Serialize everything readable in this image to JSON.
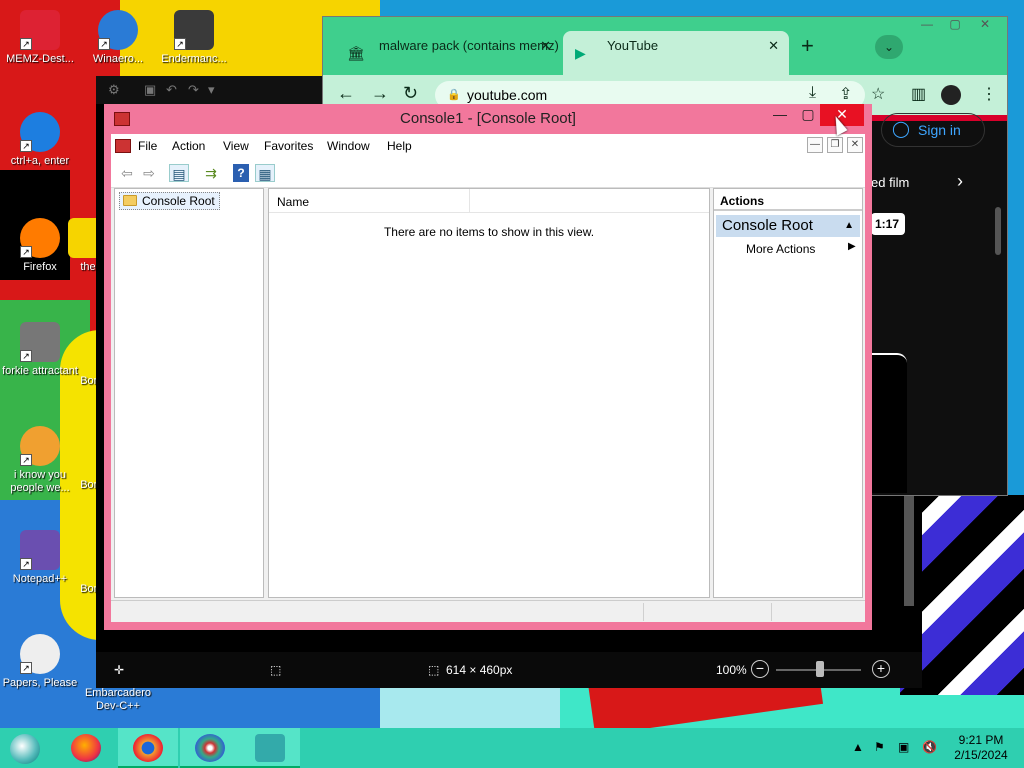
{
  "desktop": {
    "icons": [
      {
        "label": "MEMZ-Dest...",
        "color": "#d23"
      },
      {
        "label": "Winaero...",
        "color": "#2a7bd6"
      },
      {
        "label": "Endermanc...",
        "color": "#3a3a3a"
      },
      {
        "label": "ctrl+a, enter",
        "color": "#1d7ee0"
      },
      {
        "label": "Firefox",
        "color": "#ff7b00"
      },
      {
        "label": "the",
        "color": "#f6d400"
      },
      {
        "label": "forkie attractant",
        "color": "#777"
      },
      {
        "label": "Bon",
        "color": "#2a7bd6"
      },
      {
        "label": "i know you people we...",
        "color": "#f0a030"
      },
      {
        "label": "Bon",
        "color": "#2a7bd6"
      },
      {
        "label": "Notepad++",
        "color": "#6a4fb0"
      },
      {
        "label": "Bon",
        "color": "#2a7bd6"
      },
      {
        "label": "Papers, Please",
        "color": "#ddd"
      },
      {
        "label": "Embarcadero Dev-C++",
        "color": "#c22"
      }
    ]
  },
  "viewer": {
    "dimensions_label": "614 × 460px",
    "zoom_label": "100%",
    "zoom_out": "−",
    "zoom_in": "+"
  },
  "chrome": {
    "tabs": [
      {
        "title": "malware pack (contains memz)",
        "icon": "bank-icon",
        "close": "✕"
      },
      {
        "title": "YouTube",
        "icon": "play-icon",
        "close": "✕"
      }
    ],
    "new_tab": "+",
    "dropdown": "⌄",
    "url": "youtube.com",
    "signin": "Sign in",
    "film_text": "ed film",
    "time_badge": "1:17",
    "controls": {
      "minimize": "—",
      "maximize": "▢",
      "close": "✕"
    }
  },
  "mmc": {
    "title": "Console1 - [Console Root]",
    "controls": {
      "minimize": "—",
      "maximize": "▢",
      "close": "✕"
    },
    "child_controls": {
      "minimize": "—",
      "restore": "❐",
      "close": "✕"
    },
    "menu": [
      "File",
      "Action",
      "View",
      "Favorites",
      "Window",
      "Help"
    ],
    "tree_root": "Console Root",
    "column_name": "Name",
    "empty_message": "There are no items to show in this view.",
    "actions": {
      "header": "Actions",
      "group": "Console Root",
      "item": "More Actions"
    }
  },
  "taskbar": {
    "time": "9:21 PM",
    "date": "2/15/2024"
  },
  "colors": {
    "mmc_frame": "#f2779c",
    "close_red": "#e81123",
    "chrome_accent": "#3fcf8d",
    "taskbar": "#2fcfb0"
  }
}
